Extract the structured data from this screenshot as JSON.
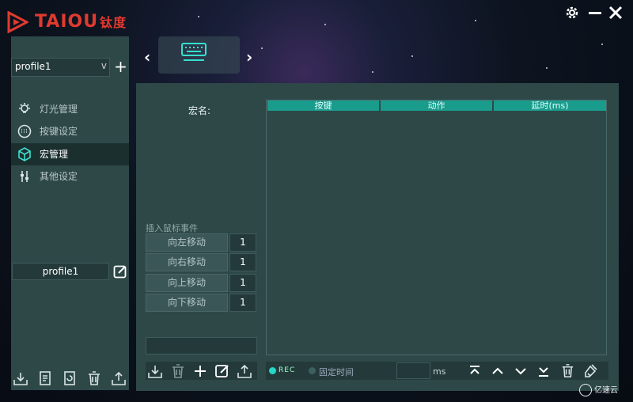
{
  "brand": {
    "logo_text": "TAIOU",
    "logo_cn": "钛度"
  },
  "window": {
    "settings_icon": "gear-icon",
    "minimize_icon": "minimize-icon",
    "close_icon": "close-icon"
  },
  "profile": {
    "selected": "profile1",
    "dropdown_indicator": "v",
    "add_label": "+",
    "current_name": "profile1"
  },
  "nav": {
    "items": [
      {
        "label": "灯光管理",
        "icon": "lightbulb-icon"
      },
      {
        "label": "按键设定",
        "icon": "keypad-icon"
      },
      {
        "label": "宏管理",
        "icon": "macro-cube-icon",
        "active": true
      },
      {
        "label": "其他设定",
        "icon": "sliders-icon"
      }
    ]
  },
  "device": {
    "prev": "‹",
    "next": "›",
    "icon": "keyboard-icon"
  },
  "macro": {
    "name_label": "宏名:",
    "table_headers": [
      "按键",
      "动作",
      "延时(ms)"
    ],
    "insert_label": "插入鼠标事件",
    "moves": [
      {
        "label": "向左移动",
        "value": "1"
      },
      {
        "label": "向右移动",
        "value": "1"
      },
      {
        "label": "向上移动",
        "value": "1"
      },
      {
        "label": "向下移动",
        "value": "1"
      }
    ],
    "rec_label": "REC",
    "fixed_time_label": "固定时间",
    "ms_unit": "ms"
  },
  "watermark": "亿速云"
}
